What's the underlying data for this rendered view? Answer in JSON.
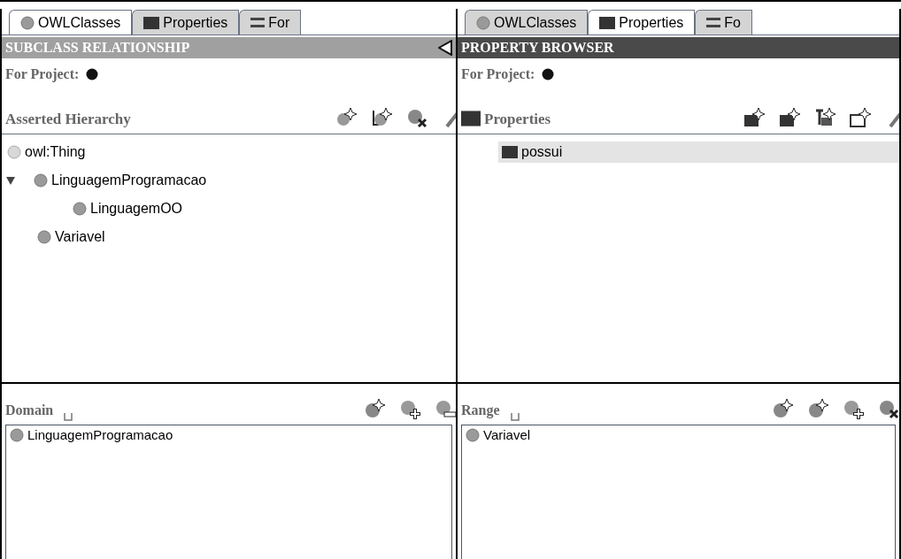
{
  "panels": [
    {
      "tabs": [
        {
          "label": "OWLClasses",
          "kind": "class",
          "selected": true
        },
        {
          "label": "Properties",
          "kind": "property",
          "selected": false
        },
        {
          "label": "For",
          "kind": "form",
          "selected": false
        }
      ],
      "header": {
        "title": "SUBCLASS RELATIONSHIP",
        "active": false,
        "collapsible": true
      },
      "for_project": "For Project:",
      "section": {
        "title": "Asserted Hierarchy",
        "kind": "class"
      },
      "tree": [
        {
          "label": "owl:Thing",
          "kind": "thing",
          "selected": false,
          "children": [
            {
              "label": "LinguagemProgramacao",
              "kind": "class",
              "selected": false,
              "expanded": true,
              "children": [
                {
                  "label": "LinguagemOO",
                  "kind": "class",
                  "selected": false
                }
              ]
            },
            {
              "label": "Variavel",
              "kind": "class",
              "selected": false
            }
          ]
        }
      ],
      "lower": {
        "title": "Domain",
        "items": [
          "LinguagemProgramacao"
        ]
      }
    },
    {
      "tabs": [
        {
          "label": "OWLClasses",
          "kind": "class",
          "selected": false
        },
        {
          "label": "Properties",
          "kind": "property",
          "selected": true
        },
        {
          "label": "Fo",
          "kind": "form",
          "selected": false
        }
      ],
      "header": {
        "title": "PROPERTY BROWSER",
        "active": true,
        "collapsible": false
      },
      "for_project": "For Project:",
      "section": {
        "title": "Properties",
        "kind": "property"
      },
      "tree": [
        {
          "label": "possui",
          "kind": "property",
          "selected": true
        }
      ],
      "lower": {
        "title": "Range",
        "items": [
          "Variavel"
        ]
      }
    }
  ]
}
